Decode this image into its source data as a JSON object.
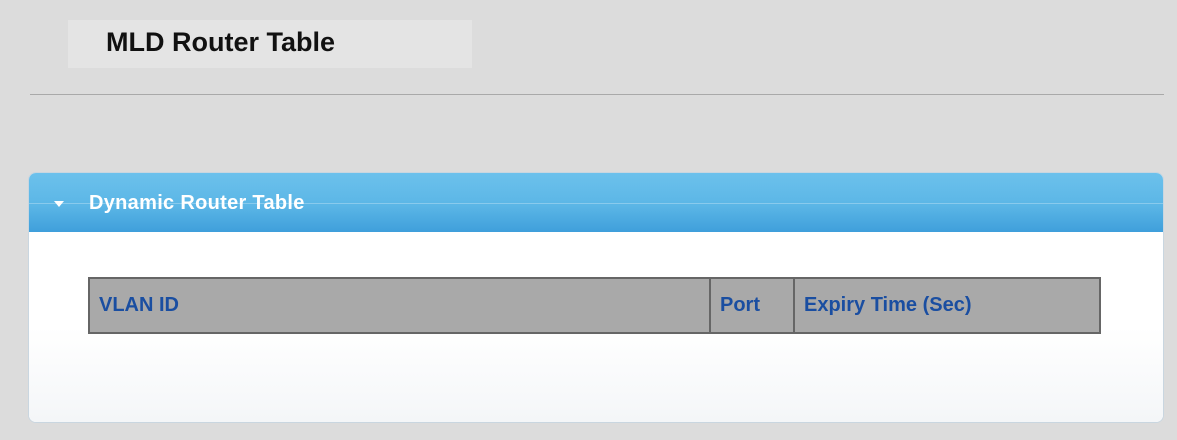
{
  "page": {
    "title": "MLD Router Table"
  },
  "panel": {
    "title": "Dynamic Router Table",
    "expanded": true,
    "arrow_icon": "triangle-down-icon",
    "header_color": "#5bb6e6"
  },
  "table": {
    "columns": [
      "VLAN ID",
      "Port",
      "Expiry Time (Sec)"
    ],
    "rows": [],
    "header_text_color": "#1a4ea1",
    "header_bg_color": "#a9a9a9"
  }
}
